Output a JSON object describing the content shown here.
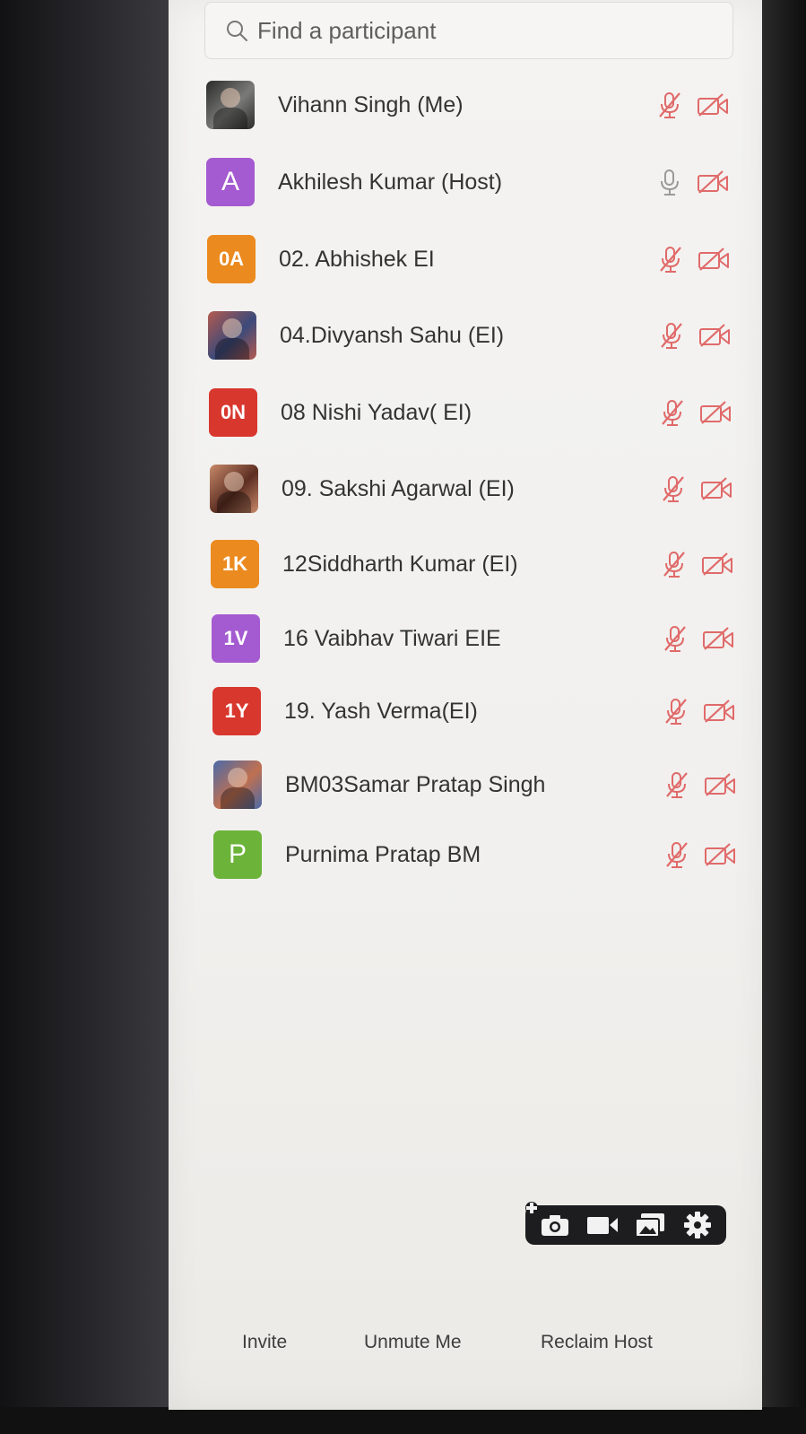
{
  "search": {
    "placeholder": "Find a participant"
  },
  "participants": [
    {
      "name": "Vihann Singh (Me)",
      "avatar": {
        "type": "photo",
        "colors": [
          "#2b2b2b",
          "#7a7a78"
        ]
      },
      "mic": "muted",
      "video": "off"
    },
    {
      "name": "Akhilesh Kumar (Host)",
      "avatar": {
        "type": "initials",
        "text": "A",
        "color": "#a45ad0"
      },
      "mic": "unmuted",
      "video": "off"
    },
    {
      "name": "02. Abhishek EI",
      "avatar": {
        "type": "initials",
        "text": "0A",
        "color": "#eb8a1f"
      },
      "mic": "muted",
      "video": "off"
    },
    {
      "name": "04.Divyansh Sahu (EI)",
      "avatar": {
        "type": "photo",
        "colors": [
          "#b45a4e",
          "#3b4a7a"
        ]
      },
      "mic": "muted",
      "video": "off"
    },
    {
      "name": "08 Nishi Yadav( EI)",
      "avatar": {
        "type": "initials",
        "text": "0N",
        "color": "#d8372e"
      },
      "mic": "muted",
      "video": "off"
    },
    {
      "name": "09. Sakshi Agarwal (EI)",
      "avatar": {
        "type": "photo",
        "colors": [
          "#c8896a",
          "#5c2e22"
        ]
      },
      "mic": "muted",
      "video": "off"
    },
    {
      "name": "12Siddharth Kumar (EI)",
      "avatar": {
        "type": "initials",
        "text": "1K",
        "color": "#eb8a1f"
      },
      "mic": "muted",
      "video": "off"
    },
    {
      "name": "16 Vaibhav Tiwari EIE",
      "avatar": {
        "type": "initials",
        "text": "1V",
        "color": "#a45ad0"
      },
      "mic": "muted",
      "video": "off"
    },
    {
      "name": "19. Yash Verma(EI)",
      "avatar": {
        "type": "initials",
        "text": "1Y",
        "color": "#d8372e"
      },
      "mic": "muted",
      "video": "off"
    },
    {
      "name": "BM03Samar Pratap Singh",
      "avatar": {
        "type": "photo",
        "colors": [
          "#4b6aa8",
          "#c07050"
        ]
      },
      "mic": "muted",
      "video": "off"
    },
    {
      "name": "Purnima Pratap BM",
      "avatar": {
        "type": "initials",
        "text": "P",
        "color": "#6cb33a"
      },
      "mic": "muted",
      "video": "off"
    }
  ],
  "toolbar": {
    "items": [
      "camera-icon",
      "video-camera-icon",
      "gallery-icon",
      "gear-icon"
    ]
  },
  "footer": {
    "invite_label": "Invite",
    "unmute_label": "Unmute Me",
    "reclaim_label": "Reclaim Host"
  },
  "colors": {
    "muted_icon": "#e06a6a",
    "unmuted_icon": "#9a9a9a",
    "panel_bg": "#f2f1ef"
  }
}
